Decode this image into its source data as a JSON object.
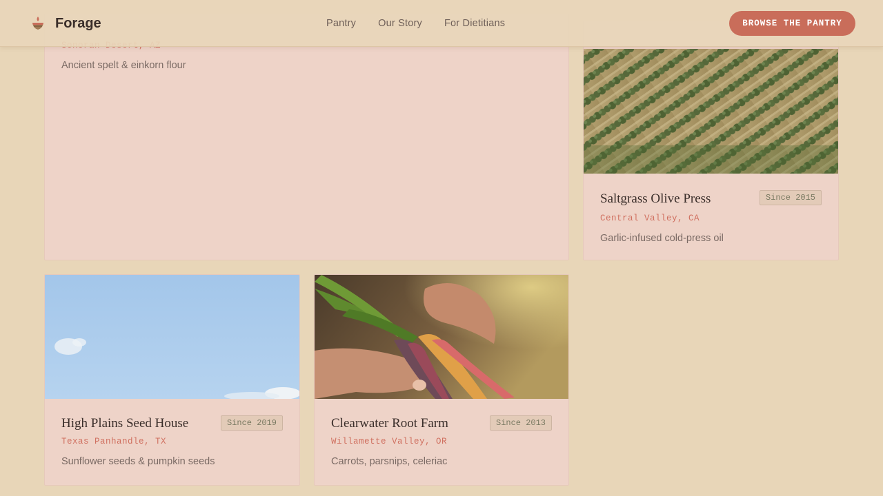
{
  "header": {
    "brand": "Forage",
    "nav": [
      "Pantry",
      "Our Story",
      "For Dietitians"
    ],
    "cta": "BROWSE THE PANTRY"
  },
  "cards": [
    {
      "name": "",
      "location": "Sonoran Desert, AZ",
      "description": "Ancient spelt & einkorn flour",
      "since": ""
    },
    {
      "name": "Saltgrass Olive Press",
      "location": "Central Valley, CA",
      "description": "Garlic-infused cold-press oil",
      "since": "Since 2015"
    },
    {
      "name": "High Plains Seed House",
      "location": "Texas Panhandle, TX",
      "description": "Sunflower seeds & pumpkin seeds",
      "since": "Since 2019"
    },
    {
      "name": "Clearwater Root Farm",
      "location": "Willamette Valley, OR",
      "description": "Carrots, parsnips, celeriac",
      "since": "Since 2013"
    }
  ],
  "colors": {
    "background": "#e8d6b8",
    "card": "#eed3c8",
    "accent": "#c96d5a",
    "location": "#d07060"
  },
  "icons": {
    "brand": "forage-logo-icon"
  }
}
